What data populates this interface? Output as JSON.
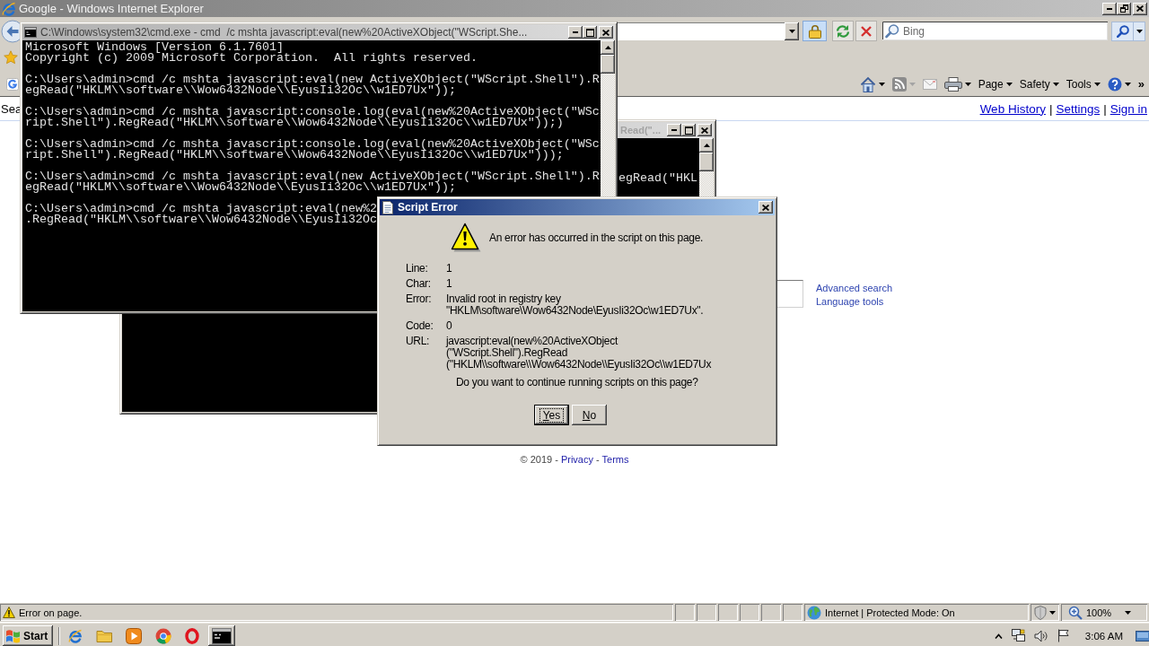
{
  "window": {
    "title": "Google - Windows Internet Explorer"
  },
  "address_bar": {
    "search": {
      "placeholder": "Bing"
    }
  },
  "command_bar": {
    "items": [
      {
        "kind": "home",
        "disabled": false
      },
      {
        "kind": "feeds",
        "disabled": true
      },
      {
        "kind": "mail",
        "disabled": true
      },
      {
        "kind": "print",
        "disabled": false
      },
      {
        "kind": "menu",
        "label": "Page",
        "disabled": false
      },
      {
        "kind": "menu",
        "label": "Safety",
        "disabled": false
      },
      {
        "kind": "menu",
        "label": "Tools",
        "disabled": false
      },
      {
        "kind": "help",
        "disabled": false
      },
      {
        "kind": "overflow",
        "label": "»",
        "disabled": false
      }
    ]
  },
  "page": {
    "nav_text": "Sea",
    "header_links": [
      {
        "label": "Web History"
      },
      {
        "label": "Settings"
      },
      {
        "label": "Sign in"
      }
    ],
    "separators": [
      "|",
      "|"
    ],
    "search_links": [
      {
        "label": "Advanced search"
      },
      {
        "label": "Language tools"
      }
    ],
    "footer": [
      {
        "kind": "text",
        "text": "© 2019 - "
      },
      {
        "kind": "link",
        "text": "Privacy"
      },
      {
        "kind": "text",
        "text": " - "
      },
      {
        "kind": "link",
        "text": "Terms"
      }
    ]
  },
  "background_console": {
    "title": "Read(\"...",
    "text": "egRead(\"HKL"
  },
  "console": {
    "title": "C:\\Windows\\system32\\cmd.exe - cmd  /c mshta javascript:eval(new%20ActiveXObject(\"WScript.She...",
    "blocks": [
      [
        "Microsoft Windows [Version 6.1.7601]",
        "Copyright (c) 2009 Microsoft Corporation.  All rights reserved."
      ],
      [
        "C:\\Users\\admin>cmd /c mshta javascript:eval(new ActiveXObject(\"WScript.Shell\").R",
        "egRead(\"HKLM\\\\software\\\\Wow6432Node\\\\EyusIi32Oc\\\\w1ED7Ux\"));"
      ],
      [
        "C:\\Users\\admin>cmd /c mshta javascript:console.log(eval(new%20ActiveXObject(\"WSc",
        "ript.Shell\").RegRead(\"HKLM\\\\software\\\\Wow6432Node\\\\EyusIi32Oc\\\\w1ED7Ux\"));)"
      ],
      [
        "C:\\Users\\admin>cmd /c mshta javascript:console.log(eval(new%20ActiveXObject(\"WSc",
        "ript.Shell\").RegRead(\"HKLM\\\\software\\\\Wow6432Node\\\\EyusIi32Oc\\\\w1ED7Ux\")));"
      ],
      [
        "C:\\Users\\admin>cmd /c mshta javascript:eval(new ActiveXObject(\"WScript.Shell\").R",
        "egRead(\"HKLM\\\\software\\\\Wow6432Node\\\\EyusIi32Oc\\\\w1ED7Ux\"));"
      ],
      [
        "C:\\Users\\admin>cmd /c mshta javascript:eval(new%2",
        ".RegRead(\"HKLM\\\\software\\\\Wow6432Node\\\\EyusIi32Oc"
      ]
    ]
  },
  "dialog": {
    "title": "Script Error",
    "message": "An error has occurred in the script on this page.",
    "fields": [
      {
        "label": "Line:",
        "lines": [
          "1"
        ]
      },
      {
        "label": "Char:",
        "lines": [
          "1"
        ]
      },
      {
        "label": "Error:",
        "lines": [
          "Invalid root in registry key",
          "\"HKLM\\software\\Wow6432Node\\EyusIi32Oc\\w1ED7Ux\"."
        ]
      },
      {
        "label": "Code:",
        "lines": [
          "0"
        ]
      },
      {
        "label": "URL:",
        "lines": [
          "javascript:eval(new%20ActiveXObject",
          "(\"WScript.Shell\").RegRead",
          "(\"HKLM\\\\software\\\\Wow6432Node\\\\EyusIi32Oc\\\\w1ED7Ux"
        ]
      }
    ],
    "question": "Do you want to continue running scripts on this page?",
    "buttons": [
      {
        "label": "Yes",
        "focused": true
      },
      {
        "label": "No",
        "focused": false
      }
    ]
  },
  "status_bar": {
    "message": "Error on page.",
    "zone": "Internet | Protected Mode: On",
    "zoom": "100%"
  },
  "taskbar": {
    "start": "Start",
    "apps": [
      {
        "kind": "explorer"
      },
      {
        "kind": "folder"
      },
      {
        "kind": "player"
      },
      {
        "kind": "orb"
      },
      {
        "kind": "ring"
      },
      {
        "kind": "console"
      }
    ],
    "clock": "3:06 AM"
  }
}
